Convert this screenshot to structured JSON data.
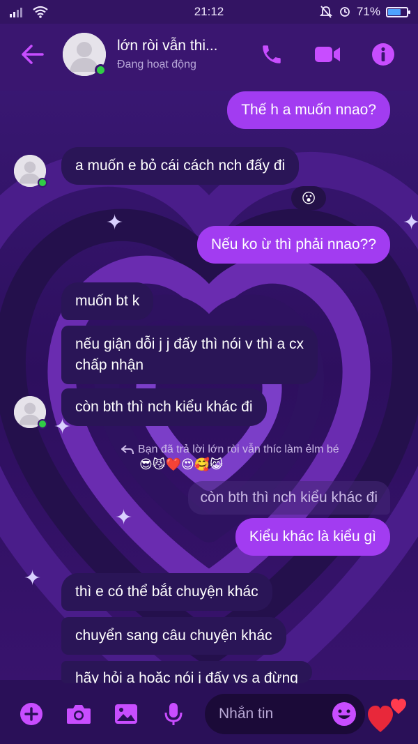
{
  "status_bar": {
    "time": "21:12",
    "battery_text": "71%",
    "battery_level": 0.71,
    "icons": [
      "signal-icon",
      "wifi-icon",
      "alarm-off-icon",
      "battery-icon"
    ]
  },
  "header": {
    "name": "lớn ròi vẫn thi...",
    "status": "Đang hoạt động",
    "icons": [
      "back-arrow-icon",
      "phone-icon",
      "video-camera-icon",
      "info-icon"
    ]
  },
  "messages": [
    {
      "dir": "out",
      "text": "Thế h a muốn nnao?"
    },
    {
      "dir": "in",
      "text": "a muốn e bỏ cái cách nch đấy đi",
      "reaction": "😮"
    },
    {
      "dir": "out",
      "text": "Nếu ko ừ thì phải nnao??"
    },
    {
      "dir": "in",
      "text": "muốn bt k"
    },
    {
      "dir": "in",
      "lines": [
        "nếu giận dỗi j j đấy thì nói v thì a cx",
        "chấp nhận"
      ]
    },
    {
      "dir": "in",
      "text": "còn bth thì nch kiểu khác đi"
    },
    {
      "dir": "out",
      "reply_note": "Bạn đã trả lời lớn ròi vẫn thíc làm ẻlm bé",
      "reply_emojis": "😎😼❤️😍🥰😸",
      "quoted": "còn bth thì nch kiểu khác đi",
      "text": "Kiểu khác là kiểu gì"
    },
    {
      "dir": "in",
      "text": "thì e có thể bắt chuyện khác"
    },
    {
      "dir": "in",
      "text": "chuyển sang câu chuyện khác"
    },
    {
      "dir": "in",
      "text": "hãy hỏi a hoặc nói j đấy vs a đừng"
    }
  ],
  "composer": {
    "placeholder": "Nhắn tin",
    "quick_reaction": "❤️",
    "icons": [
      "plus-icon",
      "camera-icon",
      "image-icon",
      "microphone-icon",
      "emoji-icon",
      "heart-icon"
    ]
  },
  "colors": {
    "accent": "#a23cf1",
    "incoming_bubble": "#2a1557",
    "online": "#31cc46",
    "background": "#2a0f52"
  }
}
